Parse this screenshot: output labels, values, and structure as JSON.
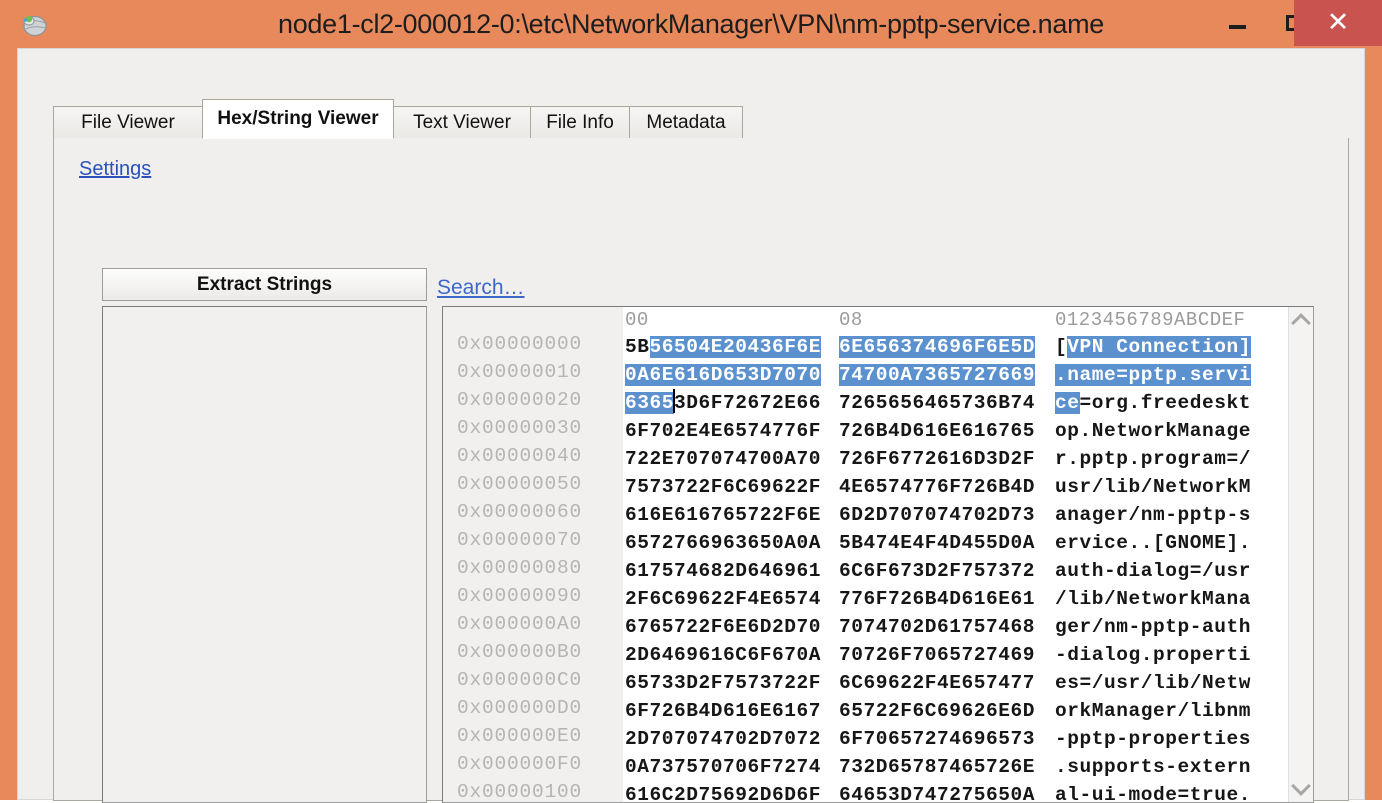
{
  "window": {
    "title": "node1-cl2-000012-0:\\etc\\NetworkManager\\VPN\\nm-pptp-service.name",
    "icon": "globe-icon",
    "titlebar_color": "#e8895c",
    "close_color": "#c9534f",
    "buttons": {
      "minimize": "minimize-icon",
      "maximize": "maximize-icon",
      "close": "✕"
    }
  },
  "tabs": [
    {
      "label": "File Viewer",
      "active": false
    },
    {
      "label": "Hex/String Viewer",
      "active": true
    },
    {
      "label": "Text Viewer",
      "active": false
    },
    {
      "label": "File Info",
      "active": false
    },
    {
      "label": "Metadata",
      "active": false
    }
  ],
  "toolbar": {
    "settings_link": "Settings",
    "extract_button": "Extract Strings",
    "search_link": "Search…"
  },
  "strings_list": {
    "items": []
  },
  "hex_viewer": {
    "selection_color": "#5b91ce",
    "headers": {
      "col0": "00",
      "col8": "08",
      "ascii": "0123456789ABCDEF"
    },
    "rows": [
      {
        "offset": "0x00000000",
        "g0": "5B56504E20436F6E",
        "g1": "6E656374696F6E5D",
        "ascii": "[VPN Connection]"
      },
      {
        "offset": "0x00000010",
        "g0": "0A6E616D653D7070",
        "g1": "74700A7365727669",
        "ascii": ".name=pptp.servi"
      },
      {
        "offset": "0x00000020",
        "g0": "63653D6F72672E66",
        "g1": "7265656465736B74",
        "ascii": "ce=org.freedeskt"
      },
      {
        "offset": "0x00000030",
        "g0": "6F702E4E6574776F",
        "g1": "726B4D616E616765",
        "ascii": "op.NetworkManage"
      },
      {
        "offset": "0x00000040",
        "g0": "722E707074700A70",
        "g1": "726F6772616D3D2F",
        "ascii": "r.pptp.program=/"
      },
      {
        "offset": "0x00000050",
        "g0": "7573722F6C69622F",
        "g1": "4E6574776F726B4D",
        "ascii": "usr/lib/NetworkM"
      },
      {
        "offset": "0x00000060",
        "g0": "616E616765722F6E",
        "g1": "6D2D707074702D73",
        "ascii": "anager/nm-pptp-s"
      },
      {
        "offset": "0x00000070",
        "g0": "6572766963650A0A",
        "g1": "5B474E4F4D455D0A",
        "ascii": "ervice..[GNOME]."
      },
      {
        "offset": "0x00000080",
        "g0": "617574682D646961",
        "g1": "6C6F673D2F757372",
        "ascii": "auth-dialog=/usr"
      },
      {
        "offset": "0x00000090",
        "g0": "2F6C69622F4E6574",
        "g1": "776F726B4D616E61",
        "ascii": "/lib/NetworkMana"
      },
      {
        "offset": "0x000000A0",
        "g0": "6765722F6E6D2D70",
        "g1": "7074702D61757468",
        "ascii": "ger/nm-pptp-auth"
      },
      {
        "offset": "0x000000B0",
        "g0": "2D6469616C6F670A",
        "g1": "70726F7065727469",
        "ascii": "-dialog.properti"
      },
      {
        "offset": "0x000000C0",
        "g0": "65733D2F7573722F",
        "g1": "6C69622F4E657477",
        "ascii": "es=/usr/lib/Netw"
      },
      {
        "offset": "0x000000D0",
        "g0": "6F726B4D616E6167",
        "g1": "65722F6C69626E6D",
        "ascii": "orkManager/libnm"
      },
      {
        "offset": "0x000000E0",
        "g0": "2D707074702D7072",
        "g1": "6F70657274696573",
        "ascii": "-pptp-properties"
      },
      {
        "offset": "0x000000F0",
        "g0": "0A737570706F7274",
        "g1": "732D65787465726E",
        "ascii": ".supports-extern"
      },
      {
        "offset": "0x00000100",
        "g0": "616C2D75692D6D6F",
        "g1": "64653D747275650A",
        "ascii": "al-ui-mode=true."
      }
    ],
    "selection": {
      "row0_g0_unselected_prefix": "5B",
      "row0_g0_selected": "56504E20436F6E",
      "row0_g1_selected": "6E656374696F6E5D",
      "row0_ascii_unselected_prefix": "[",
      "row0_ascii_selected": "VPN Connection]",
      "row1_all_selected": true,
      "row2_g0_selected": "6365",
      "row2_g0_rest": "3D6F72672E66",
      "row2_ascii_selected": "ce",
      "row2_ascii_rest": "=org.freedeskt"
    },
    "scrollbar": {
      "up_arrow": "chevron-up-icon",
      "down_arrow": "chevron-down-icon"
    }
  }
}
